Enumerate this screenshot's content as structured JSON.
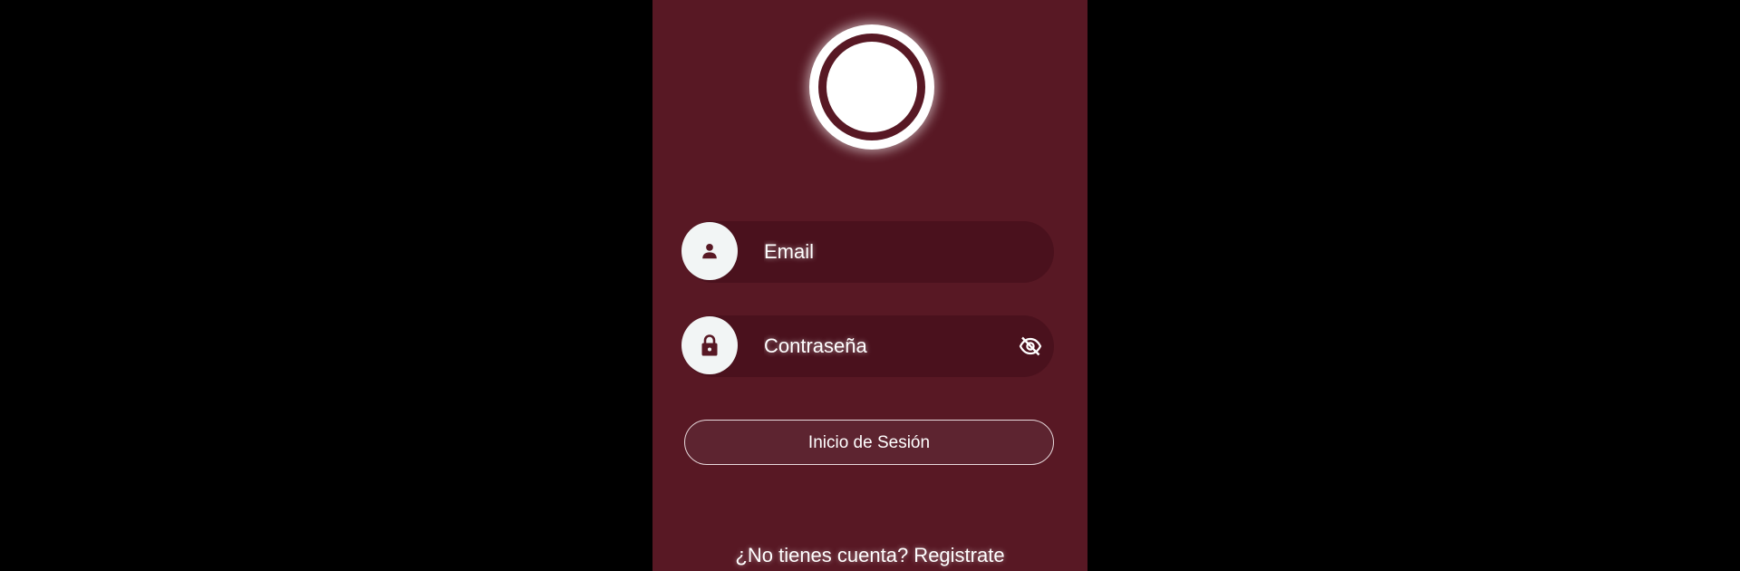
{
  "login": {
    "logo_icon": "circle-logo",
    "email": {
      "icon": "person-icon",
      "placeholder": "Email",
      "value": ""
    },
    "password": {
      "icon": "lock-icon",
      "placeholder": "Contraseña",
      "value": "",
      "visibility_icon": "eye-off-icon"
    },
    "submit_label": "Inicio de Sesión",
    "signup_text": "¿No tienes cuenta? Registrate"
  },
  "colors": {
    "background": "#581824",
    "field_background": "#4a111d",
    "icon_circle": "#f2f5f5",
    "button_background": "#5d2430",
    "text": "#ffffff"
  }
}
